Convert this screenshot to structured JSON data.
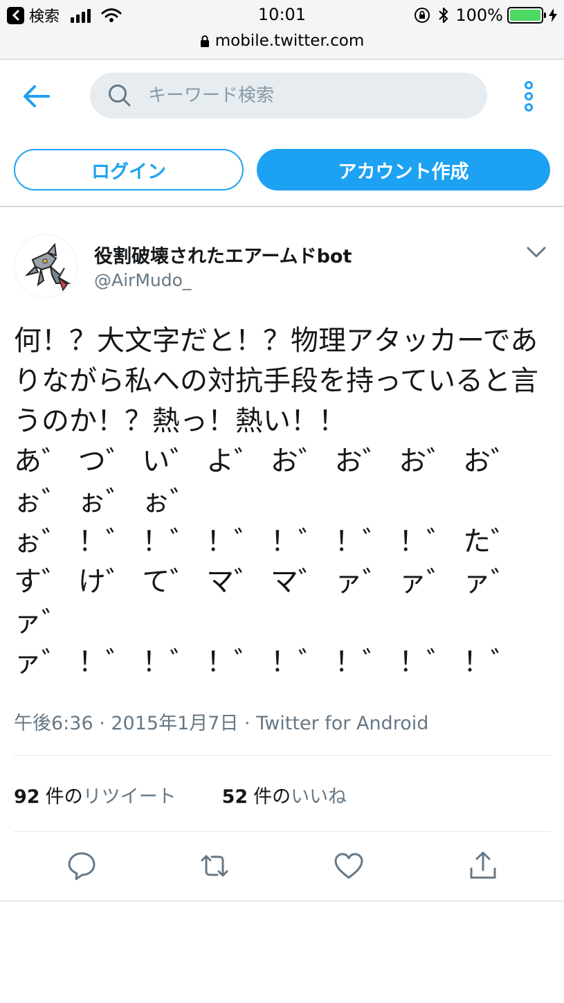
{
  "status_bar": {
    "back_app": "検索",
    "time": "10:01",
    "battery": "100%",
    "url": "mobile.twitter.com"
  },
  "header": {
    "search_placeholder": "キーワード検索",
    "login_label": "ログイン",
    "signup_label": "アカウント作成"
  },
  "tweet": {
    "display_name": "役割破壊されたエアームドbot",
    "username": "@AirMudo_",
    "text": "何！？大文字だと！？物理アタッカーでありながら私への対抗手段を持っていると言うのか！？熱っ！熱い！！\nあ゛ つ゛ い゛ よ゛ お゛ お゛ お゛ お゛\nぉ゛ ぉ゛ ぉ゛\nぉ゛ ！゛ ！゛ ！゛ ！゛ ！゛ ！゛ た゛\nす゛ け゛ て゛ マ゛ マ゛ ァ゛ ァ゛ ァ゛\nァ゛\nァ゛ ！゛ ！゛ ！゛ ！゛ ！゛ ！゛ ！゛",
    "meta": "午後6:36 · 2015年1月7日 · Twitter for Android",
    "retweet_count": "92",
    "retweet_unit": "件の",
    "retweet_label": "リツイート",
    "like_count": "52",
    "like_unit": "件の",
    "like_label": "いいね"
  },
  "colors": {
    "accent": "#1da1f2",
    "secondary_text": "#657786",
    "battery": "#4cd964"
  },
  "icons": [
    "back-arrow-icon",
    "search-icon",
    "more-vertical-icon",
    "chevron-down-icon",
    "reply-icon",
    "retweet-icon",
    "like-icon",
    "share-icon"
  ]
}
